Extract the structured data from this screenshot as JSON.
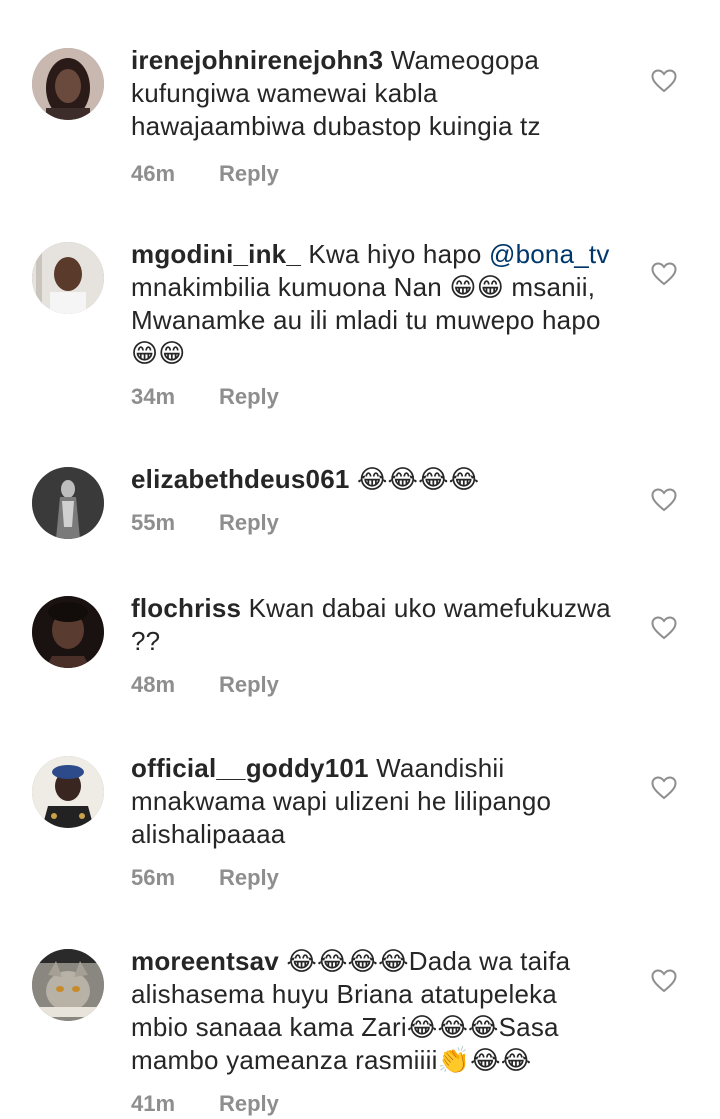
{
  "comments": [
    {
      "username": "irenejohnirenejohn3",
      "text_before": " Wameogopa kufungiwa wamewai kabla hawajaambiwa dubastop kuingia tz",
      "mention": "",
      "text_after": "",
      "time": "46m",
      "reply": "Reply",
      "avatar_color": "#3b2a28"
    },
    {
      "username": "mgodini_ink_",
      "text_before": " Kwa hiyo hapo ",
      "mention": "@bona_tv",
      "text_after": " mnakimbilia kumuona Nan 😁😁 msanii, Mwanamke au ili mladi tu muwepo hapo 😁😁",
      "time": "34m",
      "reply": "Reply",
      "avatar_color": "#7b6a5c"
    },
    {
      "username": "elizabethdeus061",
      "text_before": " 😂😂😂😂",
      "mention": "",
      "text_after": "",
      "time": "55m",
      "reply": "Reply",
      "avatar_color": "#2a2a2a"
    },
    {
      "username": "flochriss",
      "text_before": " Kwan dabai uko wamefukuzwa ??",
      "mention": "",
      "text_after": "",
      "time": "48m",
      "reply": "Reply",
      "avatar_color": "#3a2420"
    },
    {
      "username": "official__goddy101",
      "text_before": " Waandishii mnakwama wapi ulizeni he lilipango alishalipaaaa",
      "mention": "",
      "text_after": "",
      "time": "56m",
      "reply": "Reply",
      "avatar_color": "#d9d4cb"
    },
    {
      "username": "moreentsav",
      "text_before": " 😂😂😂😂Dada wa taifa alishasema huyu Briana atatupeleka mbio sanaaa kama Zari😂😂😂Sasa mambo yameanza rasmiiii👏😂😂",
      "mention": "",
      "text_after": "",
      "time": "41m",
      "reply": "Reply",
      "avatar_color": "#6c6a64"
    }
  ],
  "icons": {
    "like": "heart-outline-icon"
  },
  "colors": {
    "text": "#262626",
    "meta": "#8e8e8e",
    "mention": "#00376b"
  }
}
